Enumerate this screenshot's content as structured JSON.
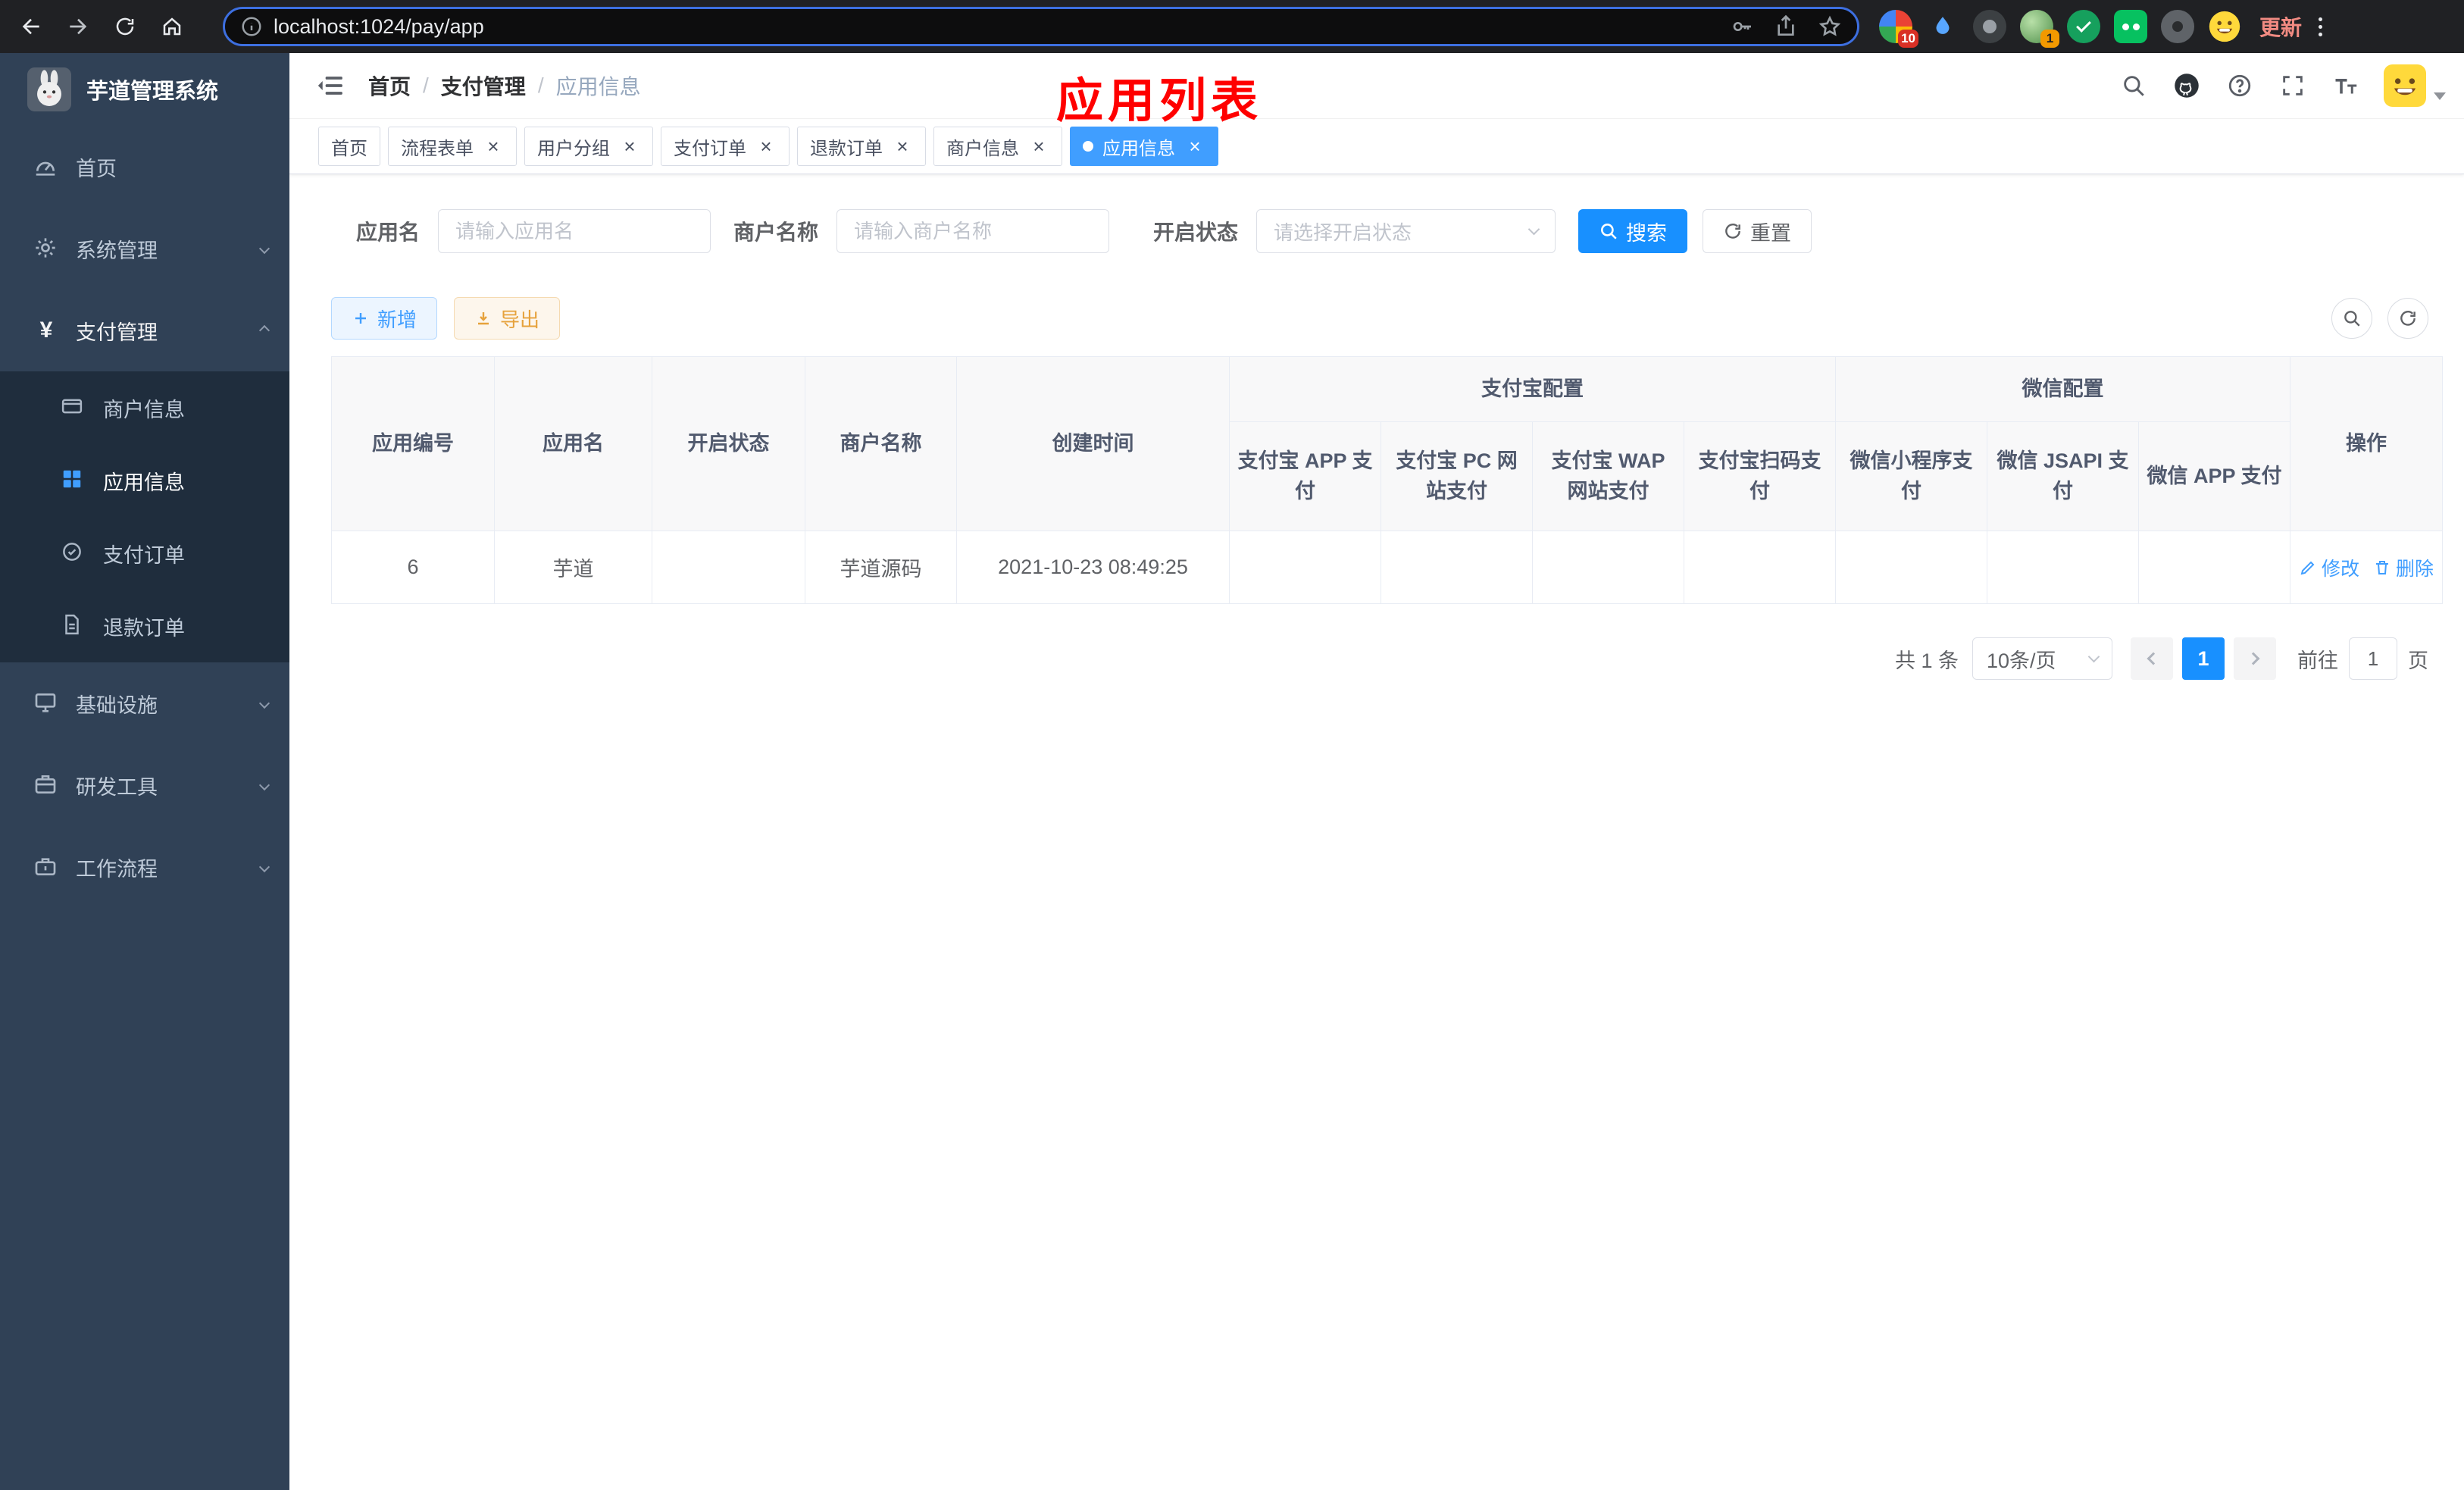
{
  "browser": {
    "url": "localhost:1024/pay/app",
    "update_label": "更新",
    "ext_badge_1": "10",
    "ext_badge_2": "1"
  },
  "colors": {
    "primary": "#1890ff",
    "link": "#409eff",
    "tab_active": "#409eff",
    "success": "#13ce66",
    "danger": "#f56c6c",
    "warning": "#e6a23c",
    "annotation": "#ff0000",
    "sidebar_bg": "#304156",
    "submenu_bg": "#1f2d3d"
  },
  "sidebar": {
    "logo_title": "芋道管理系统",
    "menu": [
      {
        "label": "首页"
      },
      {
        "label": "系统管理"
      },
      {
        "label": "支付管理"
      },
      {
        "label": "基础设施"
      },
      {
        "label": "研发工具"
      },
      {
        "label": "工作流程"
      }
    ],
    "pay_submenu": [
      {
        "label": "商户信息"
      },
      {
        "label": "应用信息"
      },
      {
        "label": "支付订单"
      },
      {
        "label": "退款订单"
      }
    ]
  },
  "navbar": {
    "breadcrumb": [
      "首页",
      "支付管理",
      "应用信息"
    ],
    "separator": "/",
    "annotation": "应用列表"
  },
  "tabs": [
    {
      "label": "首页"
    },
    {
      "label": "流程表单"
    },
    {
      "label": "用户分组"
    },
    {
      "label": "支付订单"
    },
    {
      "label": "退款订单"
    },
    {
      "label": "商户信息"
    },
    {
      "label": "应用信息"
    }
  ],
  "filters": {
    "app_name": {
      "label": "应用名",
      "placeholder": "请输入应用名",
      "value": ""
    },
    "merchant_name": {
      "label": "商户名称",
      "placeholder": "请输入商户名称",
      "value": ""
    },
    "status": {
      "label": "开启状态",
      "placeholder": "请选择开启状态"
    },
    "search_label": "搜索",
    "reset_label": "重置"
  },
  "toolbar": {
    "add_label": "新增",
    "export_label": "导出"
  },
  "table": {
    "groups": {
      "alipay": "支付宝配置",
      "wechat": "微信配置"
    },
    "columns": {
      "app_id": "应用编号",
      "app_name": "应用名",
      "status": "开启状态",
      "merchant_name": "商户名称",
      "create_time": "创建时间",
      "alipay_app": "支付宝 APP 支付",
      "alipay_pc": "支付宝 PC 网站支付",
      "alipay_wap": "支付宝 WAP 网站支付",
      "alipay_qr": "支付宝扫码支付",
      "wechat_lite": "微信小程序支付",
      "wechat_jsapi": "微信 JSAPI 支付",
      "wechat_app": "微信 APP 支付",
      "action": "操作"
    },
    "rows": [
      {
        "app_id": "6",
        "app_name": "芋道",
        "status_enabled": true,
        "merchant_name": "芋道源码",
        "create_time": "2021-10-23 08:49:25",
        "alipay_app": false,
        "alipay_pc": false,
        "alipay_wap": false,
        "alipay_qr": false,
        "wechat_lite": false,
        "wechat_jsapi": true,
        "wechat_app": false
      }
    ],
    "actions": {
      "edit_label": "修改",
      "delete_label": "删除"
    }
  },
  "pagination": {
    "total_label": "共 1 条",
    "page_size_label": "10条/页",
    "current_page": "1",
    "goto_label": "前往",
    "goto_value": "1",
    "goto_suffix": "页"
  }
}
